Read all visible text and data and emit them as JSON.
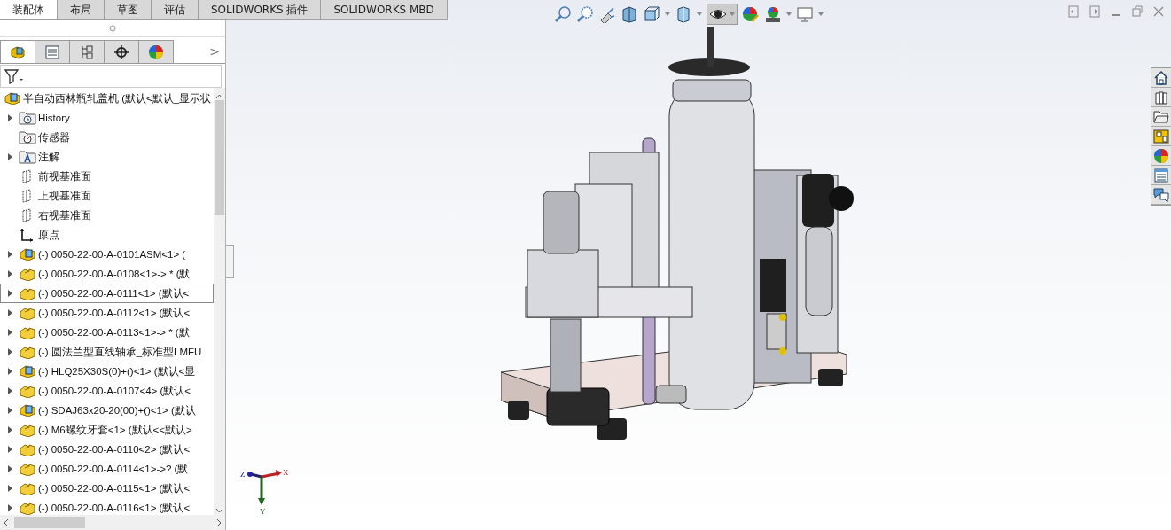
{
  "command_tabs": [
    {
      "label": "装配体",
      "selected": true
    },
    {
      "label": "布局",
      "selected": false
    },
    {
      "label": "草图",
      "selected": false
    },
    {
      "label": "评估",
      "selected": false
    },
    {
      "label": "SOLIDWORKS 插件",
      "selected": false
    },
    {
      "label": "SOLIDWORKS MBD",
      "selected": false
    }
  ],
  "panel_tabs": [
    {
      "kind": "feature",
      "selected": true
    },
    {
      "kind": "property",
      "selected": false
    },
    {
      "kind": "config",
      "selected": false
    },
    {
      "kind": "dimxpert",
      "selected": false
    },
    {
      "kind": "display",
      "selected": false
    }
  ],
  "panel_more": ">",
  "tree": {
    "root": "半自动西林瓶轧盖机  (默认<默认_显示状",
    "items": [
      {
        "kind": "history",
        "label": "History",
        "expandable": true,
        "selected": false
      },
      {
        "kind": "sensor",
        "label": "传感器",
        "expandable": false,
        "selected": false
      },
      {
        "kind": "annotation",
        "label": "注解",
        "expandable": true,
        "selected": false
      },
      {
        "kind": "plane",
        "label": "前视基准面",
        "expandable": false,
        "selected": false
      },
      {
        "kind": "plane",
        "label": "上视基准面",
        "expandable": false,
        "selected": false
      },
      {
        "kind": "plane",
        "label": "右视基准面",
        "expandable": false,
        "selected": false
      },
      {
        "kind": "origin",
        "label": "原点",
        "expandable": false,
        "selected": false
      },
      {
        "kind": "assembly",
        "label": "(-) 0050-22-00-A-0101ASM<1> (",
        "expandable": true,
        "selected": false
      },
      {
        "kind": "part",
        "label": "(-) 0050-22-00-A-0108<1>-> * (默",
        "expandable": true,
        "selected": false
      },
      {
        "kind": "part",
        "label": "(-) 0050-22-00-A-0111<1> (默认<",
        "expandable": true,
        "selected": true
      },
      {
        "kind": "part",
        "label": "(-) 0050-22-00-A-0112<1> (默认<",
        "expandable": true,
        "selected": false
      },
      {
        "kind": "part",
        "label": "(-) 0050-22-00-A-0113<1>-> * (默",
        "expandable": true,
        "selected": false
      },
      {
        "kind": "part",
        "label": "(-) 圆法兰型直线轴承_标准型LMFU",
        "expandable": true,
        "selected": false
      },
      {
        "kind": "assembly",
        "label": "(-) HLQ25X30S(0)+()<1> (默认<显",
        "expandable": true,
        "selected": false
      },
      {
        "kind": "part",
        "label": "(-) 0050-22-00-A-0107<4> (默认<",
        "expandable": true,
        "selected": false
      },
      {
        "kind": "assembly",
        "label": "(-) SDAJ63x20-20(00)+()<1> (默认",
        "expandable": true,
        "selected": false
      },
      {
        "kind": "part",
        "label": "(-) M6螺纹牙套<1> (默认<<默认>",
        "expandable": true,
        "selected": false
      },
      {
        "kind": "part",
        "label": "(-) 0050-22-00-A-0110<2> (默认<",
        "expandable": true,
        "selected": false
      },
      {
        "kind": "part",
        "label": "(-) 0050-22-00-A-0114<1>->? (默",
        "expandable": true,
        "selected": false
      },
      {
        "kind": "part",
        "label": "(-) 0050-22-00-A-0115<1> (默认<",
        "expandable": true,
        "selected": false
      },
      {
        "kind": "part",
        "label": "(-) 0050-22-00-A-0116<1> (默认<",
        "expandable": true,
        "selected": false
      }
    ]
  },
  "triad": {
    "x": "X",
    "y": "Y",
    "z": "Z"
  },
  "task_pane": [
    {
      "kind": "home"
    },
    {
      "kind": "library"
    },
    {
      "kind": "folder"
    },
    {
      "kind": "palette"
    },
    {
      "kind": "appearance"
    },
    {
      "kind": "properties"
    },
    {
      "kind": "forum"
    }
  ]
}
